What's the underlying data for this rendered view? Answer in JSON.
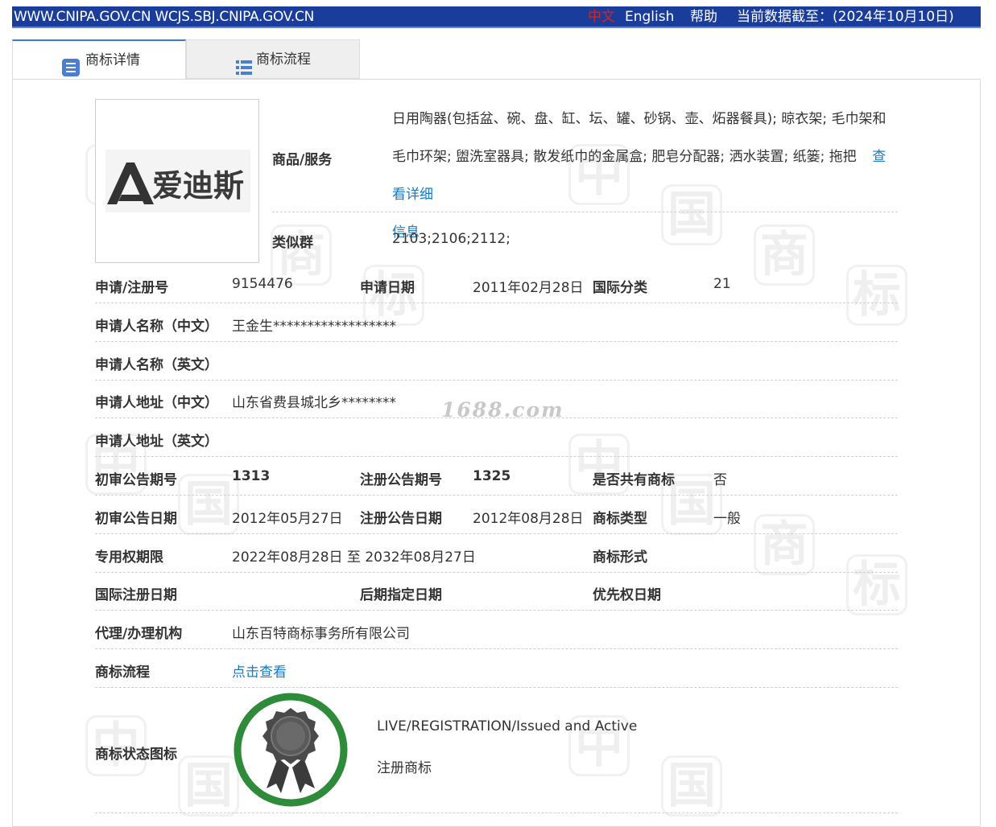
{
  "topbar": {
    "site": "WWW.CNIPA.GOV.CN WCJS.SBJ.CNIPA.GOV.CN",
    "lang_cn": "中文",
    "lang_en": "English",
    "help": "帮助",
    "as_of": "当前数据截至：(2024年10月10日)"
  },
  "tabs": [
    {
      "label": "商标详情",
      "icon": "document-icon",
      "active": true
    },
    {
      "label": "商标流程",
      "icon": "list-icon",
      "active": false
    }
  ],
  "logo": {
    "text": "爱迪斯",
    "mark": "A"
  },
  "goods": {
    "label": "商品/服务",
    "text": "日用陶器(包括盆、碗、盘、缸、坛、罐、砂锅、壶、炻器餐具); 晾衣架; 毛巾架和毛巾环架; 盥洗室器具; 散发纸巾的金属盒; 肥皂分配器; 洒水装置; 纸篓; 拖把",
    "detail_link": "查看详细信息",
    "detail_link_a": "查看详细",
    "detail_link_b": "信息"
  },
  "similar_group": {
    "label": "类似群",
    "value": "2103;2106;2112;"
  },
  "fields": {
    "reg_no": {
      "label": "申请/注册号",
      "value": "9154476"
    },
    "app_date": {
      "label": "申请日期",
      "value": "2011年02月28日"
    },
    "intl_class": {
      "label": "国际分类",
      "value": "21"
    },
    "applicant_cn": {
      "label": "申请人名称（中文）",
      "value": "王金生******************"
    },
    "applicant_en": {
      "label": "申请人名称（英文）",
      "value": ""
    },
    "address_cn": {
      "label": "申请人地址（中文）",
      "value": "山东省费县城北乡********"
    },
    "address_en": {
      "label": "申请人地址（英文）",
      "value": ""
    },
    "prelim_no": {
      "label": "初审公告期号",
      "value": "1313"
    },
    "reg_notice_no": {
      "label": "注册公告期号",
      "value": "1325"
    },
    "shared": {
      "label": "是否共有商标",
      "value": "否"
    },
    "prelim_date": {
      "label": "初审公告日期",
      "value": "2012年05月27日"
    },
    "reg_notice_date": {
      "label": "注册公告日期",
      "value": "2012年08月28日"
    },
    "tm_type": {
      "label": "商标类型",
      "value": "一般"
    },
    "exclusive_term": {
      "label": "专用权期限",
      "value": "2022年08月28日 至 2032年08月27日"
    },
    "tm_form": {
      "label": "商标形式",
      "value": ""
    },
    "intl_reg_date": {
      "label": "国际注册日期",
      "value": ""
    },
    "later_designation": {
      "label": "后期指定日期",
      "value": ""
    },
    "priority_date": {
      "label": "优先权日期",
      "value": ""
    },
    "agent": {
      "label": "代理/办理机构",
      "value": "山东百特商标事务所有限公司"
    },
    "process": {
      "label": "商标流程",
      "value": "点击查看"
    },
    "status_icon": {
      "label": "商标状态图标",
      "value": ""
    }
  },
  "status": {
    "en": "LIVE/REGISTRATION/Issued and Active",
    "cn": "注册商标",
    "icon": "award-badge-icon",
    "ring_color": "#2e8b3a"
  },
  "watermark": {
    "text": "1688.com",
    "chars": [
      "中",
      "国",
      "商",
      "标"
    ]
  },
  "colors": {
    "topbar": "#1a3d9c",
    "link": "#1a7bc2",
    "lang_active": "#d9241b"
  }
}
